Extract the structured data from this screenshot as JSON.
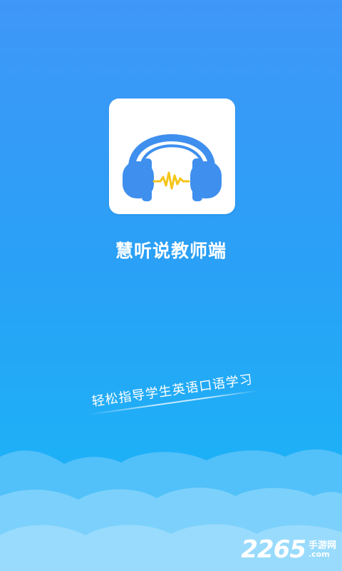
{
  "app": {
    "title": "慧听说教师端",
    "tagline": "轻松指导学生英语口语学习",
    "icon": "headphones-icon"
  },
  "watermark": {
    "number": "2265",
    "site_cn": "手游网",
    "site_en": ".com"
  },
  "colors": {
    "background_top": "#3f97f7",
    "background_bottom": "#1cb6f6",
    "headphones": "#3f8fee",
    "sound_wave": "#f5c518",
    "cloud": "#7fd3fb"
  }
}
